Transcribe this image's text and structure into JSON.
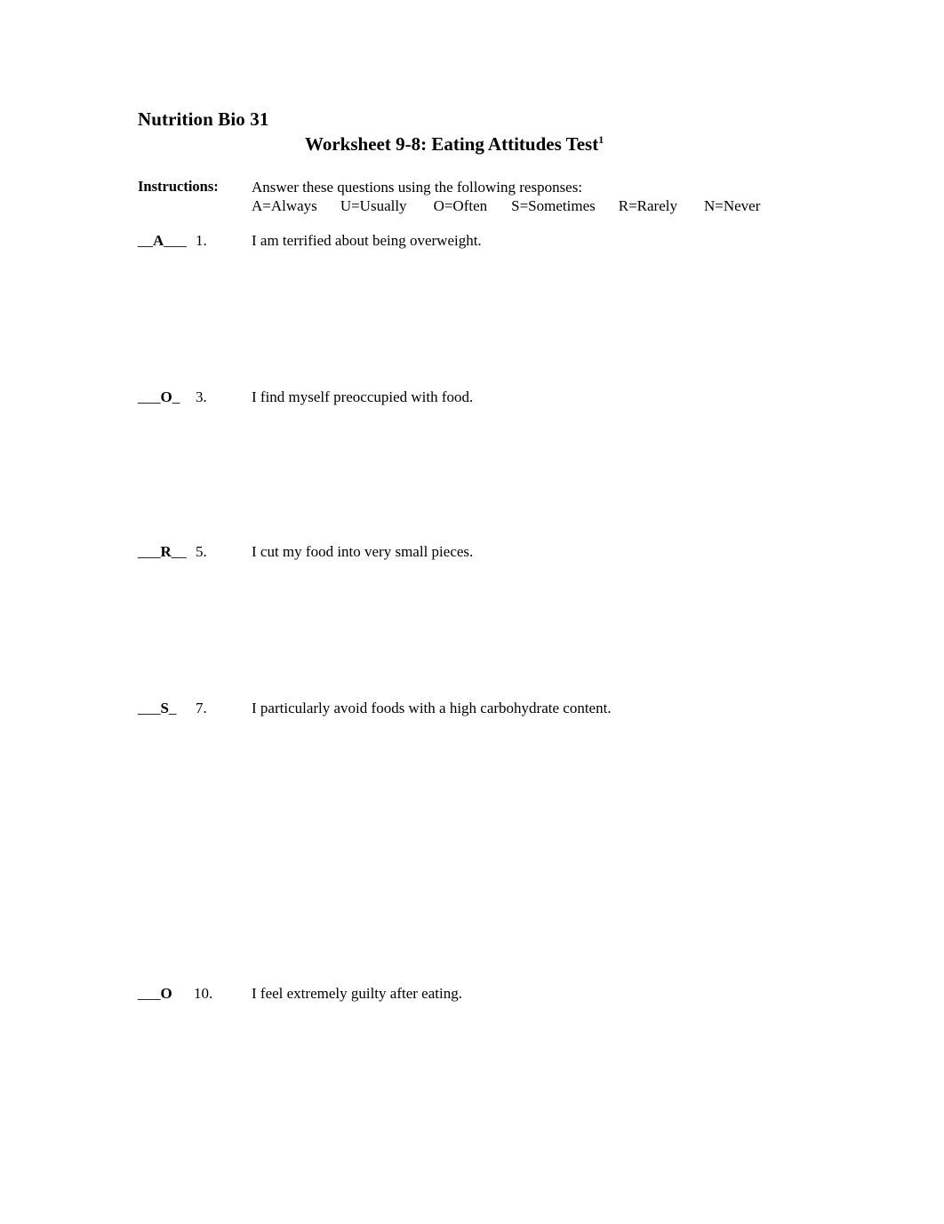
{
  "document": {
    "course_title": "Nutrition Bio 31",
    "worksheet_title": "Worksheet 9-8: Eating Attitudes Test",
    "worksheet_title_footnote_marker": "1"
  },
  "instructions": {
    "label": "Instructions:",
    "lead": "Answer these questions using the following responses:",
    "legend": [
      "A=Always",
      "U=Usually",
      "O=Often",
      "S=Sometimes",
      "R=Rarely",
      "N=Never"
    ]
  },
  "questions": [
    {
      "number": "1.",
      "answer": "A",
      "rule_before": "__",
      "rule_after": "___",
      "text": "I am terrified about being overweight."
    },
    {
      "number": "3.",
      "answer": "O",
      "rule_before": "___",
      "rule_after": "_",
      "text": "I find myself preoccupied with food."
    },
    {
      "number": "5.",
      "answer": "R",
      "rule_before": "___",
      "rule_after": "__",
      "text": "I cut my food into very small pieces."
    },
    {
      "number": "7.",
      "answer": "S",
      "rule_before": "___",
      "rule_after": "_",
      "text": "I particularly avoid foods with a high carbohydrate content."
    },
    {
      "number": "10.",
      "answer": "O",
      "rule_before": "___",
      "rule_after": "",
      "text": "I feel extremely guilty after eating."
    }
  ]
}
